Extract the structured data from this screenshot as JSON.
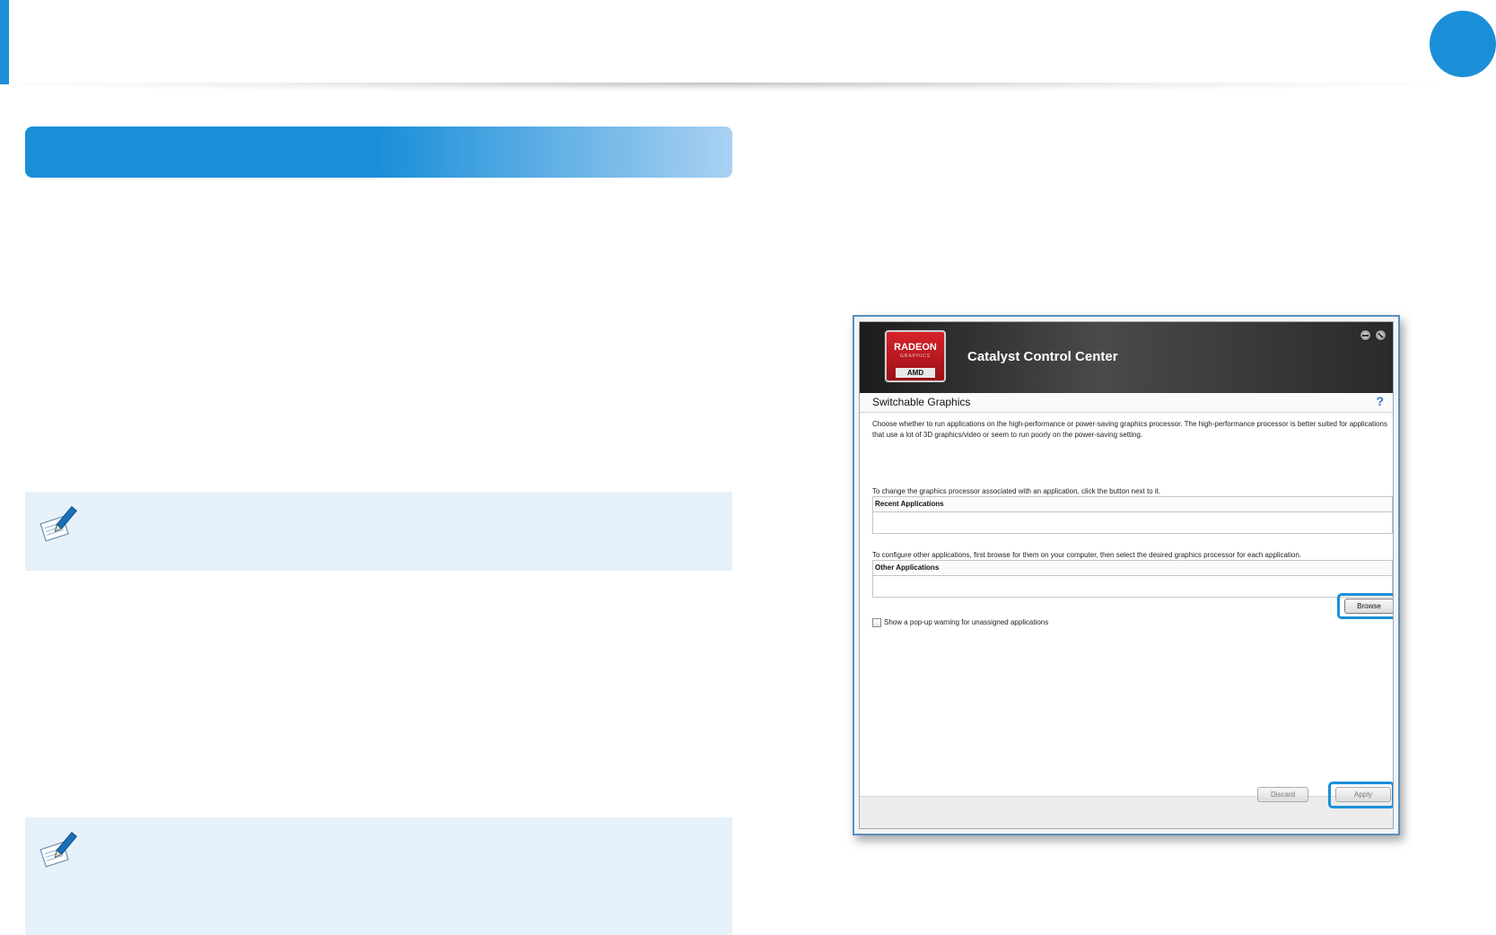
{
  "colors": {
    "accent": "#1a8fd8",
    "note_bg": "#e7f1fa"
  },
  "screenshot": {
    "app_title": "Catalyst Control Center",
    "logo": {
      "line1": "RADEON",
      "line2": "GRAPHICS",
      "line3": "AMD"
    },
    "panel_title": "Switchable Graphics",
    "help": "?",
    "description": "Choose whether to run applications on the high-performance or power-saving graphics processor. The high-performance processor is better suited for applications that use a lot of 3D graphics/video or seem to run poorly on the power-saving setting.",
    "hint_recent": "To change the graphics processor associated with an application, click the button next to it.",
    "recent_header": "Recent Applications",
    "hint_other": "To configure other applications, first browse for them on your computer, then select the desired graphics processor for each application.",
    "other_header": "Other Applications",
    "browse_label": "Browse",
    "checkbox_label": "Show a pop-up warning for unassigned applications",
    "discard_label": "Discard",
    "apply_label": "Apply"
  }
}
